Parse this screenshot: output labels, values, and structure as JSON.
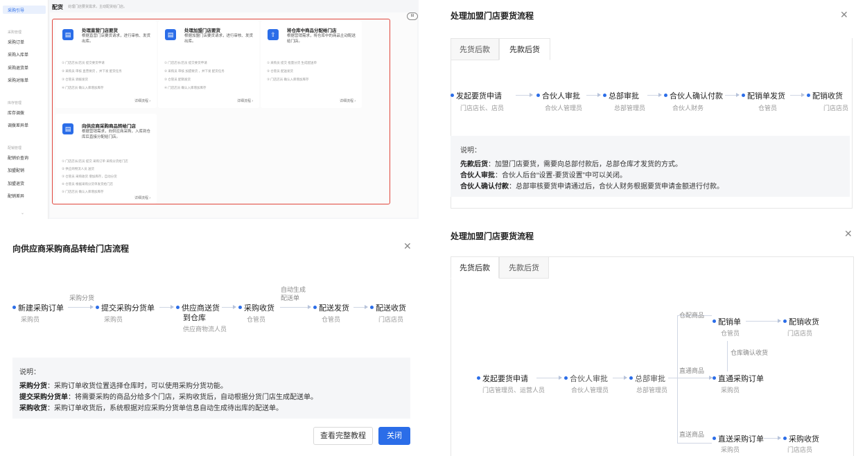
{
  "config_page": {
    "sidebar": {
      "active_item": "采购引导",
      "group1": "采购管理",
      "group1_items": [
        "采购订单",
        "采购入库单",
        "采购退货单",
        "采购对账单"
      ],
      "group2": "库存管理",
      "group2_items": [
        "库存调拨",
        "调拨差异单"
      ],
      "group3": "配销管理",
      "group3_items": [
        "配销价查询",
        "加盟配销",
        "加盟退货",
        "配销差异"
      ]
    },
    "title": "配货",
    "subtitle": "处理门店要货需求，主动配货给门店。",
    "collapse_icon": "collapse-icon",
    "cards": [
      {
        "title": "处理直营门店要货",
        "desc": "根据直营门店要货请求，进行审核、发货出库。",
        "steps": [
          "① 门店店长/店员 提交要货申请",
          "② 采购员 审核 直营要货 ，并下发 配货任务",
          "③ 仓管员 调拨发货",
          "④ 门店店员 确认入库增加库存"
        ],
        "more": "详细流程 ›"
      },
      {
        "title": "处理加盟门店要货",
        "desc": "根据加盟门店要货请求，进行审核、发货出库。",
        "steps": [
          "① 门店店长/店员 提交要货申请",
          "② 采购员 审核 加盟要货 ，并下发 配货任务",
          "③ 仓管员 配销发货",
          "④ 门店店员 确认入库增加库存"
        ],
        "more": "详细流程 ›"
      },
      {
        "title": "将仓库中商品分配给门店",
        "desc": "根据营销需求，将仓库中的商品主动配送给门店。",
        "steps": [
          "① 采购员 提交 批量分货 生成配送单",
          "② 仓管员 配送发货",
          "③ 门店店员 确认入库增加库存"
        ],
        "more": "详细流程 ›"
      },
      {
        "title": "向供应商采购商品转给门店",
        "desc": "根据营销需求，向供应商采购，入库到仓库后直接分配给门店。",
        "steps": [
          "① 门店店长/店员 提交 采购订单 采购分货给门店",
          "② 供应商物流人员 送货",
          "③ 仓管员 采购收货 增加库存，自动分货",
          "④ 仓管员 根据采购分货单发货给门店",
          "⑤ 门店店员 确认入库增加库存"
        ],
        "more": "详细流程 ›"
      }
    ]
  },
  "dialog_join_paid": {
    "title": "处理加盟门店要货流程",
    "close_icon": "close-icon",
    "tabs": [
      "先货后款",
      "先款后货"
    ],
    "active_tab": "先款后货",
    "nodes": [
      {
        "name": "发起要货申请",
        "role": "门店店长、店员"
      },
      {
        "name": "合伙人审批",
        "role": "合伙人管理员"
      },
      {
        "name": "总部审批",
        "role": "总部管理员"
      },
      {
        "name": "合伙人确认付款",
        "role": "合伙人财务"
      },
      {
        "name": "配销单发货",
        "role": "仓管员"
      },
      {
        "name": "配销收货",
        "role": "门店店员"
      }
    ],
    "note_head": "说明：",
    "notes": [
      {
        "key": "先款后货",
        "text": "：加盟门店要货，需要向总部付款后，总部仓库才发货的方式。"
      },
      {
        "key": "合伙人审批",
        "text": "：合伙人后台“设置-要货设置”中可以关闭。"
      },
      {
        "key": "合伙人确认付款",
        "text": "：总部审核要货申请通过后，合伙人财务根据要货申请金额进行付款。"
      }
    ]
  },
  "dialog_supplier": {
    "title": "向供应商采购商品转给门店流程",
    "close_icon": "close-icon",
    "nodes": [
      {
        "name": "新建采购订单",
        "role": "采购员"
      },
      {
        "name": "提交采购分货单",
        "role": "采购员"
      },
      {
        "name": "供应商送货",
        "name2": "到仓库",
        "role": "供应商物流人员"
      },
      {
        "name": "采购收货",
        "role": "仓管员"
      },
      {
        "name": "配送发货",
        "role": "仓管员"
      },
      {
        "name": "配送收货",
        "role": "门店店员"
      }
    ],
    "edge_label_1": "采购分货",
    "edge_label_2": "自动生成",
    "edge_label_2b": "配送单",
    "note_head": "说明：",
    "notes": [
      {
        "key": "采购分货",
        "text": "：采购订单收货位置选择仓库时，可以使用采购分货功能。"
      },
      {
        "key": "提交采购分货单",
        "text": "：将需要采购的商品分给多个门店，采购收货后，自动根据分货门店生成配送单。"
      },
      {
        "key": "采购收货",
        "text": "：采购订单收货后，系统根据对应采购分货单信息自动生成待出库的配送单。"
      }
    ],
    "btn_tutorial": "查看完整教程",
    "btn_close": "关闭"
  },
  "dialog_join_goods": {
    "title": "处理加盟门店要货流程",
    "close_icon": "close-icon",
    "tabs": [
      "先货后款",
      "先款后货"
    ],
    "active_tab": "先货后款",
    "start": {
      "name": "发起要货申请",
      "role": "门店管理员、运营人员"
    },
    "partner": {
      "name": "合伙人审批",
      "role": "合伙人管理员"
    },
    "hq": {
      "name": "总部审批",
      "role": "总部管理员"
    },
    "branch_labels": [
      "仓配商品",
      "直通商品",
      "直送商品"
    ],
    "sales_order": {
      "name": "配销单",
      "role": "仓管员"
    },
    "sales_receive": {
      "name": "配销收货",
      "role": "门店店员"
    },
    "warehouse_confirm": "仓库确认收货",
    "direct_order": {
      "name": "直通采购订单",
      "role": "采购员"
    },
    "ship_order": {
      "name": "直送采购订单",
      "role": "采购员"
    },
    "purchase_receive": {
      "name": "采购收货",
      "role": "门店店员"
    }
  }
}
